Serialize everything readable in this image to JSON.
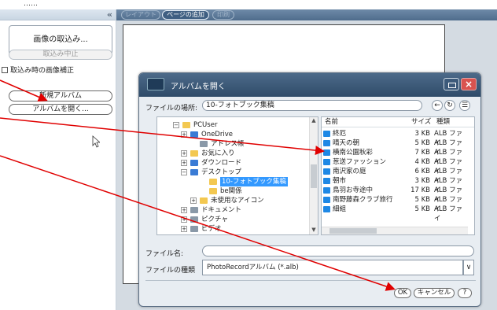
{
  "top_label": "……",
  "left_panel": {
    "collapse_glyph": "«",
    "import_button": "画像の取込み...",
    "stop_button": "取込み中止",
    "correction_checkbox": "取込み時の画像補正",
    "new_album_button": "新規アルバム",
    "open_album_button": "アルバムを開く..."
  },
  "toolbar": {
    "layout_button": "レイアウト",
    "add_page_button": "ページの追加",
    "print_button": "印刷"
  },
  "dialog": {
    "title": "アルバムを開く",
    "close_glyph": "×",
    "location_label": "ファイルの場所:",
    "location_value": "10-フォトブック集稿",
    "back_glyph": "←",
    "refresh_glyph": "↻",
    "view_glyph": "☰",
    "tree": [
      {
        "label": "PCUser",
        "expander": "−",
        "icon": "f-yellow",
        "indent": 60
      },
      {
        "label": "OneDrive",
        "expander": "+",
        "icon": "f-blue",
        "indent": 70
      },
      {
        "label": "アドレス帳",
        "expander": "",
        "icon": "f-gray",
        "indent": 82
      },
      {
        "label": "お気に入り",
        "expander": "+",
        "icon": "f-yellow",
        "indent": 70
      },
      {
        "label": "ダウンロード",
        "expander": "+",
        "icon": "f-blue",
        "indent": 70
      },
      {
        "label": "デスクトップ",
        "expander": "−",
        "icon": "f-blue",
        "indent": 70
      },
      {
        "label": "10-フォトブック集稿",
        "expander": "",
        "icon": "f-yellow",
        "indent": 94,
        "selected": true
      },
      {
        "label": "be関係",
        "expander": "",
        "icon": "f-yellow",
        "indent": 94
      },
      {
        "label": "未使用なアイコン",
        "expander": "+",
        "icon": "f-yellow",
        "indent": 82
      },
      {
        "label": "ドキュメント",
        "expander": "+",
        "icon": "f-gray",
        "indent": 70
      },
      {
        "label": "ピクチャ",
        "expander": "+",
        "icon": "f-gray",
        "indent": 70
      },
      {
        "label": "ビデオ",
        "expander": "+",
        "icon": "f-gray",
        "indent": 70
      }
    ],
    "list_headers": {
      "name": "名前",
      "size": "サイズ",
      "type": "種類"
    },
    "files": [
      {
        "name": "終厄",
        "size": "3 KB",
        "type": "ALB ファイ"
      },
      {
        "name": "晴天の朝",
        "size": "5 KB",
        "type": "ALB ファイ"
      },
      {
        "name": "横南公園秋彩",
        "size": "7 KB",
        "type": "ALB ファイ"
      },
      {
        "name": "葱送ファッション",
        "size": "4 KB",
        "type": "ALB ファイ"
      },
      {
        "name": "南沢家の庭",
        "size": "6 KB",
        "type": "ALB ファイ"
      },
      {
        "name": "朝市",
        "size": "3 KB",
        "type": "ALB ファイ"
      },
      {
        "name": "鳥羽お寺途中",
        "size": "17 KB",
        "type": "ALB ファイ"
      },
      {
        "name": "南野藤森クラブ旅行",
        "size": "5 KB",
        "type": "ALB ファイ"
      },
      {
        "name": "細組",
        "size": "5 KB",
        "type": "ALB ファイ"
      }
    ],
    "filename_label": "ファイル名:",
    "filetype_label": "ファイルの種類",
    "filetype_value": "PhotoRecordアルバム (*.alb)",
    "ok_button": "OK",
    "cancel_button": "キャンセル",
    "help_button": "?"
  },
  "annotation_color": "#e00000"
}
